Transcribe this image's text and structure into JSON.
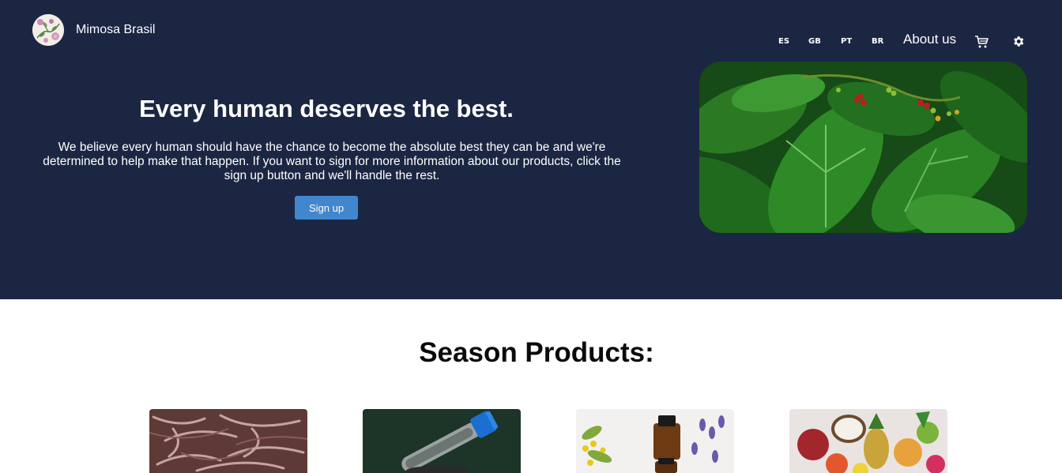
{
  "header": {
    "brand": "Mimosa Brasil",
    "languages": [
      "ES",
      "GB",
      "PT",
      "BR"
    ],
    "about_label": "About us"
  },
  "hero": {
    "title": "Every human deserves the best.",
    "text": "We believe every human should have the chance to become the absolute best they can be and we're determined to help make that happen. If you want to sign for more information about our products, click the sign up button and we'll handle the rest.",
    "signup_label": "Sign up"
  },
  "season": {
    "title": "Season Products:"
  },
  "colors": {
    "hero_bg": "#1b2642",
    "button": "#4286cd"
  }
}
